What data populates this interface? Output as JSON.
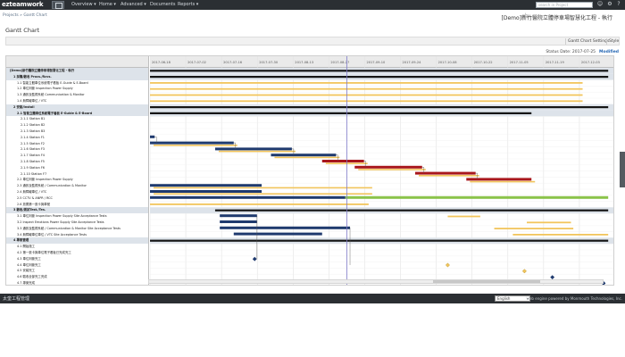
{
  "app": {
    "logo": "ezteamwork"
  },
  "nav": {
    "items": [
      {
        "label": "Overview ▾"
      },
      {
        "label": "Home ▾"
      },
      {
        "label": "Advanced ▾"
      },
      {
        "label": "Documents"
      },
      {
        "label": "Reports ▾"
      }
    ],
    "search_placeholder": "search in Project"
  },
  "header": {
    "breadcrumb": "Projects  »  Gantt Chart",
    "project_title": "[Demo]新竹醫院立體停車場智慧化工程 - 執行",
    "page_title": "Gantt Chart",
    "toolbar": {
      "settings": "Gantt Chart Settings",
      "style": "Style"
    },
    "status_date": "Status Date: 2017-07-25",
    "modified": "Modified"
  },
  "gantt": {
    "timeline_labels": [
      "2017-06-18",
      "2017-07-02",
      "2017-07-16",
      "2017-07-30",
      "2017-08-13",
      "2017-08-27",
      "2017-09-10",
      "2017-09-24",
      "2017-10-08",
      "2017-10-22",
      "2017-11-05",
      "2017-11-19",
      "2017-12-03"
    ],
    "colors": {
      "plan": "#f2c55c",
      "actual": "#1f3a6e",
      "late": "#a8161c",
      "summary": "#151515",
      "accepted": "#8bc34a",
      "milestone": "#1f3a6e",
      "milestone_plan": "#f2c55c",
      "today": "#7d79c8"
    },
    "tasks": [
      {
        "name": "[Demo]新竹醫院立體停車場智慧化工程 - 執行",
        "level": 0,
        "summary": true,
        "bars": [
          {
            "start": 0.0,
            "end": 0.985,
            "type": "summary"
          }
        ]
      },
      {
        "name": "1 採購/驗收 Procs./Rcvs.",
        "level": 1,
        "summary": true,
        "bars": [
          {
            "start": 0.0,
            "end": 0.985,
            "type": "summary"
          }
        ]
      },
      {
        "name": "1.1 智能立體車位系統電子看板 E-Guide & E-Board",
        "level": 2,
        "summary": false,
        "bars": [
          {
            "start": 0.0,
            "end": 0.93,
            "type": "plan"
          }
        ]
      },
      {
        "name": "1.2 車位判斷 Inspection Power Supply",
        "level": 2,
        "summary": false,
        "bars": [
          {
            "start": 0.0,
            "end": 0.93,
            "type": "plan"
          }
        ]
      },
      {
        "name": "1.3 通訊及監視系統 Communication & Monitor",
        "level": 2,
        "summary": false,
        "bars": [
          {
            "start": 0.0,
            "end": 0.93,
            "type": "plan"
          }
        ]
      },
      {
        "name": "1.4 無障礙車位 / VTC",
        "level": 2,
        "summary": false,
        "bars": [
          {
            "start": 0.0,
            "end": 0.93,
            "type": "plan"
          }
        ]
      },
      {
        "name": "2 安裝/Install",
        "level": 1,
        "summary": true,
        "bars": [
          {
            "start": 0.0,
            "end": 0.985,
            "type": "summary"
          }
        ]
      },
      {
        "name": "2.1 智能立體車位系統電子看板 E-Guide & E-Board",
        "level": 2,
        "summary": true,
        "bars": [
          {
            "start": 0.0,
            "end": 0.82,
            "type": "summary"
          }
        ]
      },
      {
        "name": "2.1.1 Station B1",
        "level": 3,
        "summary": false,
        "bars": []
      },
      {
        "name": "2.1.2 Station B2",
        "level": 3,
        "summary": false,
        "bars": []
      },
      {
        "name": "2.1.3 Station B3",
        "level": 3,
        "summary": false,
        "bars": []
      },
      {
        "name": "2.1.4 Station F1",
        "level": 3,
        "summary": false,
        "bars": [
          {
            "start": 0.0,
            "end": 0.01,
            "type": "actual"
          }
        ]
      },
      {
        "name": "2.1.5 Station F2",
        "level": 3,
        "summary": false,
        "bars": [
          {
            "start": 0.0,
            "end": 0.18,
            "type": "actual"
          },
          {
            "start": 0.0,
            "end": 0.18,
            "type": "plan",
            "lower": true
          }
        ]
      },
      {
        "name": "2.1.6 Station F3",
        "level": 3,
        "summary": false,
        "bars": [
          {
            "start": 0.14,
            "end": 0.305,
            "type": "actual"
          },
          {
            "start": 0.14,
            "end": 0.305,
            "type": "plan",
            "lower": true
          }
        ]
      },
      {
        "name": "2.1.7 Station F4",
        "level": 3,
        "summary": false,
        "bars": [
          {
            "start": 0.26,
            "end": 0.4,
            "type": "actual"
          },
          {
            "start": 0.26,
            "end": 0.4,
            "type": "plan",
            "lower": true
          }
        ]
      },
      {
        "name": "2.1.8 Station F5",
        "level": 3,
        "summary": false,
        "bars": [
          {
            "start": 0.37,
            "end": 0.46,
            "type": "late"
          },
          {
            "start": 0.37,
            "end": 0.46,
            "type": "plan",
            "lower": true
          }
        ]
      },
      {
        "name": "2.1.9 Station F6",
        "level": 3,
        "summary": false,
        "bars": [
          {
            "start": 0.44,
            "end": 0.585,
            "type": "late"
          },
          {
            "start": 0.44,
            "end": 0.585,
            "type": "plan",
            "lower": true
          }
        ]
      },
      {
        "name": "2.1.10 Station F7",
        "level": 3,
        "summary": false,
        "bars": [
          {
            "start": 0.57,
            "end": 0.7,
            "type": "late"
          },
          {
            "start": 0.57,
            "end": 0.7,
            "type": "plan",
            "lower": true
          }
        ]
      },
      {
        "name": "2.2 車位判斷 Inspection Power Supply",
        "level": 2,
        "summary": false,
        "bars": [
          {
            "start": 0.68,
            "end": 0.82,
            "type": "late"
          },
          {
            "start": 0.68,
            "end": 0.82,
            "type": "plan",
            "lower": true
          }
        ]
      },
      {
        "name": "2.3 通訊及監視系統 / Communication & Monitor",
        "level": 2,
        "summary": false,
        "bars": [
          {
            "start": 0.0,
            "end": 0.24,
            "type": "actual"
          },
          {
            "start": 0.0,
            "end": 0.47,
            "type": "plan",
            "lower": true
          }
        ]
      },
      {
        "name": "2.4 無障礙車位 / VTC",
        "level": 2,
        "summary": false,
        "bars": [
          {
            "start": 0.0,
            "end": 0.24,
            "type": "actual"
          },
          {
            "start": 0.0,
            "end": 0.47,
            "type": "plan",
            "lower": true
          }
        ]
      },
      {
        "name": "2.5 CCTV & ANPR / RCC",
        "level": 2,
        "summary": false,
        "bars": [
          {
            "start": 0.0,
            "end": 0.42,
            "type": "actual"
          },
          {
            "start": 0.42,
            "end": 0.985,
            "type": "accepted"
          }
        ]
      },
      {
        "name": "2.6 放置第一張卡與車號",
        "level": 2,
        "summary": false,
        "bars": [
          {
            "start": 0.0,
            "end": 0.47,
            "type": "plan"
          }
        ]
      },
      {
        "name": "3 驗收/測試Test./Tes.",
        "level": 1,
        "summary": true,
        "bars": [
          {
            "start": 0.14,
            "end": 0.985,
            "type": "summary"
          }
        ]
      },
      {
        "name": "3.1 車位判斷 Inspection Power Supply Site Acceptance Tests",
        "level": 2,
        "summary": false,
        "bars": [
          {
            "start": 0.15,
            "end": 0.23,
            "type": "actual"
          },
          {
            "start": 0.64,
            "end": 0.71,
            "type": "plan"
          }
        ]
      },
      {
        "name": "3.2 Inspect Emotions Power Supply Site Acceptance Tests",
        "level": 2,
        "summary": false,
        "bars": [
          {
            "start": 0.15,
            "end": 0.23,
            "type": "actual"
          },
          {
            "start": 0.81,
            "end": 0.905,
            "type": "plan"
          }
        ]
      },
      {
        "name": "3.3 通訊及監視系統 / Communication & Monitor Site Acceptance Tests",
        "level": 2,
        "summary": false,
        "bars": [
          {
            "start": 0.15,
            "end": 0.43,
            "type": "actual"
          },
          {
            "start": 0.74,
            "end": 0.91,
            "type": "plan"
          }
        ]
      },
      {
        "name": "3.4 無障礙車位車位 / VTC Site Acceptance Tests",
        "level": 2,
        "summary": false,
        "bars": [
          {
            "start": 0.18,
            "end": 0.37,
            "type": "actual"
          },
          {
            "start": 0.78,
            "end": 0.985,
            "type": "plan"
          }
        ]
      },
      {
        "name": "4 專案管理",
        "level": 1,
        "summary": true,
        "bars": [
          {
            "start": 0.0,
            "end": 0.985,
            "type": "summary"
          }
        ]
      },
      {
        "name": "4.1 開始施工",
        "level": 2,
        "summary": false,
        "bars": []
      },
      {
        "name": "4.2 第一張卡與車位電子看板已完成完工",
        "level": 2,
        "summary": false,
        "bars": []
      },
      {
        "name": "4.3 車位判斷完工",
        "level": 2,
        "summary": false,
        "milestone": 0.225,
        "bars": []
      },
      {
        "name": "4.4 車位判斷完工",
        "level": 2,
        "summary": false,
        "milestone_plan": 0.64,
        "bars": []
      },
      {
        "name": "4.5 安裝完工",
        "level": 2,
        "summary": false,
        "milestone_plan": 0.805,
        "bars": []
      },
      {
        "name": "4.6 驗收全部完工完成",
        "level": 2,
        "summary": false,
        "milestone": 0.865,
        "bars": []
      },
      {
        "name": "4.7 專案完成",
        "level": 2,
        "summary": false,
        "milestone": 0.975,
        "bars": []
      }
    ]
  },
  "footer": {
    "left": "太奎工程管理",
    "language": "English",
    "right": "Web engine powered by Monmouth Technologies, Inc."
  }
}
